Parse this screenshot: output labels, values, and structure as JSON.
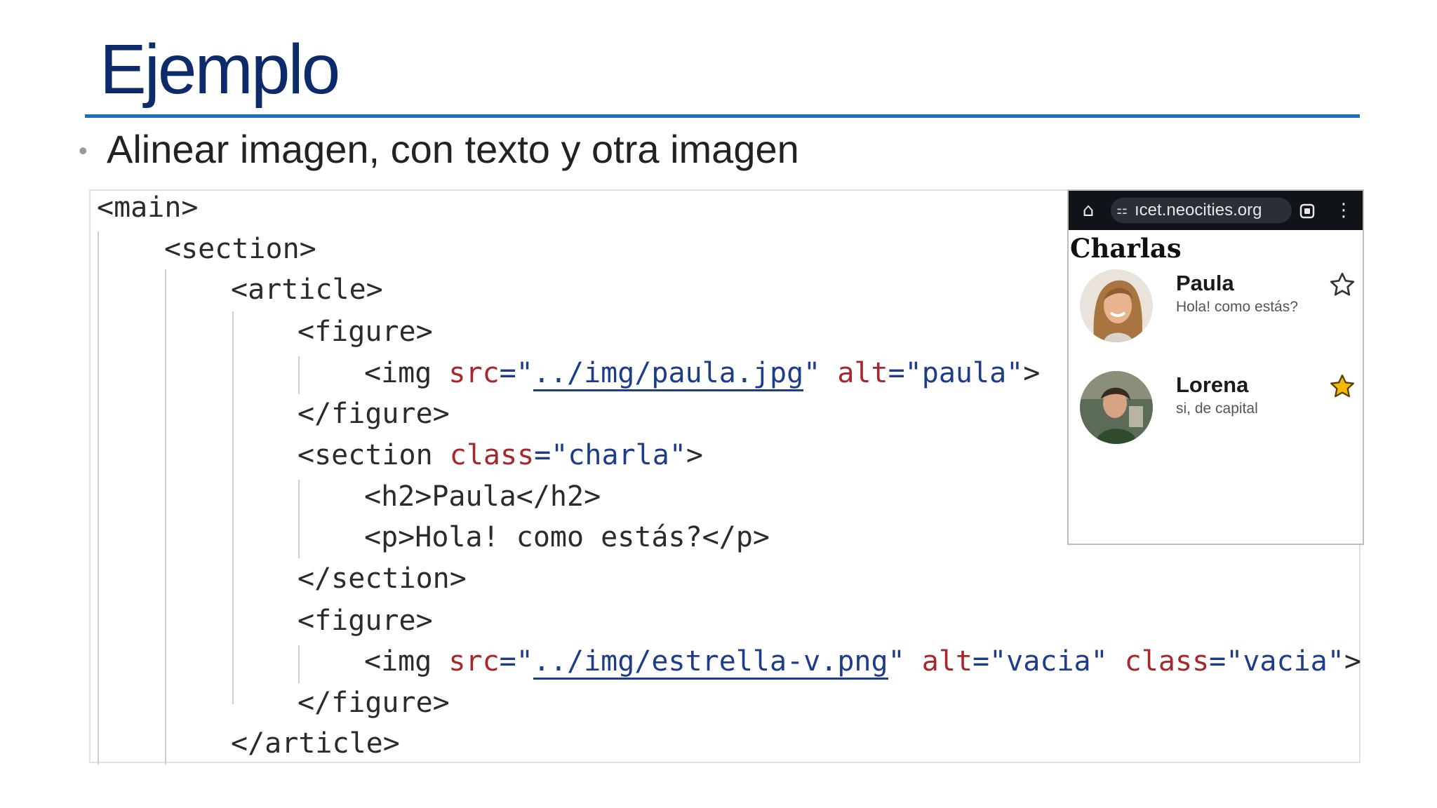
{
  "slide": {
    "title": "Ejemplo",
    "bullet": "Alinear imagen, con texto y otra imagen"
  },
  "code": {
    "l1": "<main>",
    "l2": "<section>",
    "l3": "<article>",
    "l4": "<figure>",
    "l5": {
      "open": "<img ",
      "src_attr": "src",
      "eq1": "=\"",
      "src_value": "../img/paula.jpg",
      "q1": "\" ",
      "alt_attr": "alt",
      "alt_value": "=\"paula\"",
      "close": ">"
    },
    "l6": "</figure>",
    "l7": {
      "open": "<section ",
      "class_attr": "class",
      "class_value": "=\"charla\"",
      "close": ">"
    },
    "l8": {
      "open": "<h2>",
      "text": "Paula",
      "close": "</h2>"
    },
    "l9": {
      "open": "<p>",
      "text": "Hola! como estás?",
      "close": "</p>"
    },
    "l10": "</section>",
    "l11": "<figure>",
    "l12": {
      "open": "<img ",
      "src_attr": "src",
      "eq1": "=\"",
      "src_value": "../img/estrella-v.png",
      "q1": "\" ",
      "alt_attr": "alt",
      "alt_value": "=\"vacia\" ",
      "class_attr": "class",
      "class_value": "=\"vacia\"",
      "close": ">"
    },
    "l13": "</figure>",
    "l14": "</article>"
  },
  "preview": {
    "url": "ıcet.neocities.org",
    "heading": "Charlas",
    "chats": [
      {
        "name": "Paula",
        "message": "Hola! como estás?",
        "starred": false,
        "star_icon": "star-outline-icon"
      },
      {
        "name": "Lorena",
        "message": "si, de capital",
        "starred": true,
        "star_icon": "star-filled-icon"
      }
    ],
    "colors": {
      "star_filled": "#f2b90c",
      "bar": "#101418"
    }
  }
}
